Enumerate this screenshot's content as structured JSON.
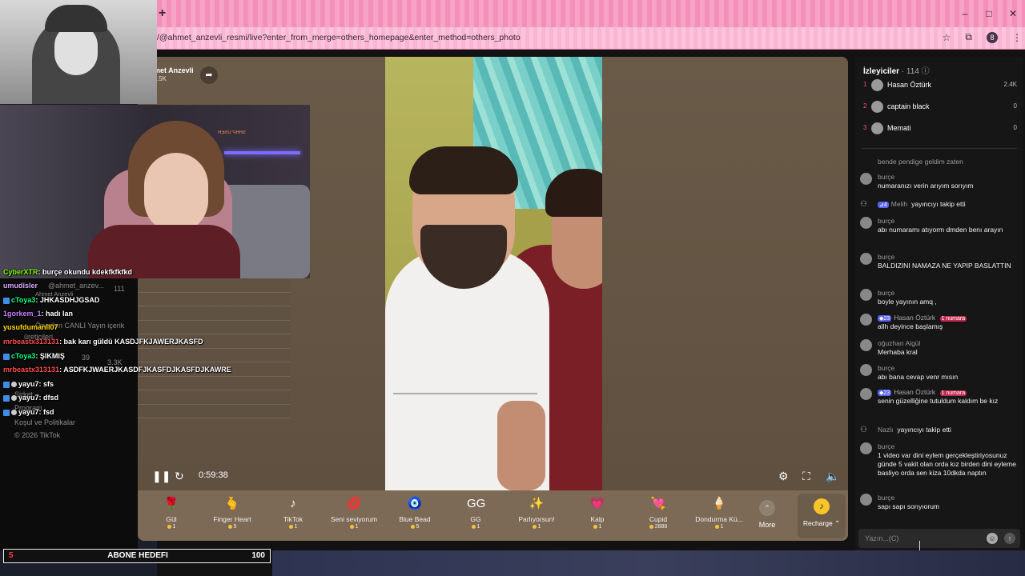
{
  "browser": {
    "new_tab_symbol": "+",
    "url": "/@ahmet_anzevli_resmi/live?enter_from_merge=others_homepage&enter_method=others_photo",
    "profile_initial": "8",
    "window_buttons": [
      "–",
      "□",
      "✕"
    ]
  },
  "host": {
    "name": "Ahmet Anzevli",
    "likes": "24.5K",
    "share_icon": "share-arrow"
  },
  "player": {
    "time": "0:59:38"
  },
  "gifts": [
    {
      "name": "Gül",
      "price": "1",
      "icon": "🌹"
    },
    {
      "name": "Finger Heart",
      "price": "5",
      "icon": "🫰"
    },
    {
      "name": "TikTok",
      "price": "1",
      "icon": "♪"
    },
    {
      "name": "Seni seviyorum",
      "price": "1",
      "icon": "💋"
    },
    {
      "name": "Blue Bead",
      "price": "5",
      "icon": "🧿"
    },
    {
      "name": "GG",
      "price": "1",
      "icon": "GG"
    },
    {
      "name": "Parlıyorsun!",
      "price": "1",
      "icon": "✨"
    },
    {
      "name": "Kalp",
      "price": "1",
      "icon": "💗"
    },
    {
      "name": "Cupid",
      "price": "2888",
      "icon": "💘"
    },
    {
      "name": "Dondurma Kü...",
      "price": "1",
      "icon": "🍦"
    }
  ],
  "gift_more": {
    "label": "More"
  },
  "recharge": {
    "label": "Recharge ⌃"
  },
  "viewers": {
    "title": "İzleyiciler",
    "count": "· 114 ⓘ",
    "top": [
      {
        "rank": "1",
        "name": "Hasan Öztürk",
        "score": "2.4K"
      },
      {
        "rank": "2",
        "name": "captain black",
        "score": "0"
      },
      {
        "rank": "3",
        "name": "Memati",
        "score": "0"
      }
    ]
  },
  "chat": [
    {
      "type": "plain",
      "text": "bende pendige geldim zaten"
    },
    {
      "type": "msg",
      "user": "burçe",
      "text": "numaranızı verin arıyım sorıyım"
    },
    {
      "type": "follow",
      "badge": "4",
      "user": "Melih",
      "text": "yayıncıyı takip etti"
    },
    {
      "type": "msg",
      "user": "burçe",
      "text": "abı numaramı atıyorm dmden benı arayın"
    },
    {
      "type": "msg",
      "user": "burçe",
      "text": "BALDIZINI NAMAZA NE YAPIP BASLATTIN"
    },
    {
      "type": "msg",
      "user": "burçe",
      "text": "boyle yayının amq ,"
    },
    {
      "type": "badged",
      "badge": "23",
      "user": "Hasan Öztürk",
      "badge2": "1 numara",
      "text": "allh deyince başlamış"
    },
    {
      "type": "msg",
      "user": "oğuzhan Algül",
      "text": "Merhaba kral"
    },
    {
      "type": "msg",
      "user": "burçe",
      "text": "abı bana cevap venr mısın"
    },
    {
      "type": "badged",
      "badge": "23",
      "user": "Hasan Öztürk",
      "badge2": "1 numara",
      "text": "senin güzelliğine tutuldum kaldım be kız"
    },
    {
      "type": "follow",
      "user": "Nazlı",
      "text": "yayıncıyı takip etti"
    },
    {
      "type": "msg",
      "user": "burçe",
      "text": "1 video var dini eylem gerçekleştiriyosunuz günde 5 vakit olan orda kız birden dini eyleme basliyo orda sen kiza 10dkda naptın"
    },
    {
      "type": "msg",
      "user": "burçe",
      "text": "sapı sapı sorıyıorum"
    }
  ],
  "chat_input": {
    "placeholder": "Yazın...(C)"
  },
  "stream_overlay": {
    "webcam_sign": "SHRP USER",
    "chat": [
      {
        "user": "CyberXTR",
        "color": "#7CFC00",
        "icon": "",
        "msg": ": burçe okundu kdekfkfkfkd"
      },
      {
        "user": "umudisler",
        "color": "#d9a8ff",
        "icon": "",
        "msg": ""
      },
      {
        "user": "cToya3",
        "color": "#00ff7f",
        "icon": "tw",
        "msg": ": JHKASDHJGSAD"
      },
      {
        "user": "1gorkem_1",
        "color": "#c77dff",
        "icon": "",
        "msg": ": hadı lan"
      },
      {
        "user": "yusufdumanll07",
        "color": "#ffd700",
        "icon": "",
        "msg": ""
      },
      {
        "user": "mrbeastx313131",
        "color": "#ff4d4d",
        "icon": "",
        "msg": ": bak karı güldü KASDJFKJAWERJKASFD"
      },
      {
        "user": "cToya3",
        "color": "#00ff7f",
        "icon": "tw",
        "msg": ": ŞIKMIŞ"
      },
      {
        "user": "mrbeastx313131",
        "color": "#ff4d4d",
        "icon": "",
        "msg": ": ASDFKJWAERJKASDFJKASFDJKASFDJKAWRE"
      },
      {
        "user": "yayu7",
        "color": "#ffffff",
        "icon": "tw2",
        "msg": ": sfs"
      },
      {
        "user": "yayu7",
        "color": "#ffffff",
        "icon": "tw2",
        "msg": ": dfsd"
      },
      {
        "user": "yayu7",
        "color": "#ffffff",
        "icon": "tw2",
        "msg": ": fsd"
      }
    ],
    "ghost": {
      "g1": "@ahmet_anzev...",
      "g2": "111",
      "g3": "Ahmet Anzevli",
      "g4": "Önerilen CANLI Yayın içerik",
      "g5": "üreticileri",
      "g6": "39",
      "g7": "3.3K",
      "g8": "Sirket",
      "g9": "Program",
      "g10": "Koşul ve Politikalar",
      "g11": "© 2026 TikTok"
    },
    "subgoal": {
      "left": "5",
      "title": "ABONE HEDEFI",
      "right": "100"
    }
  }
}
